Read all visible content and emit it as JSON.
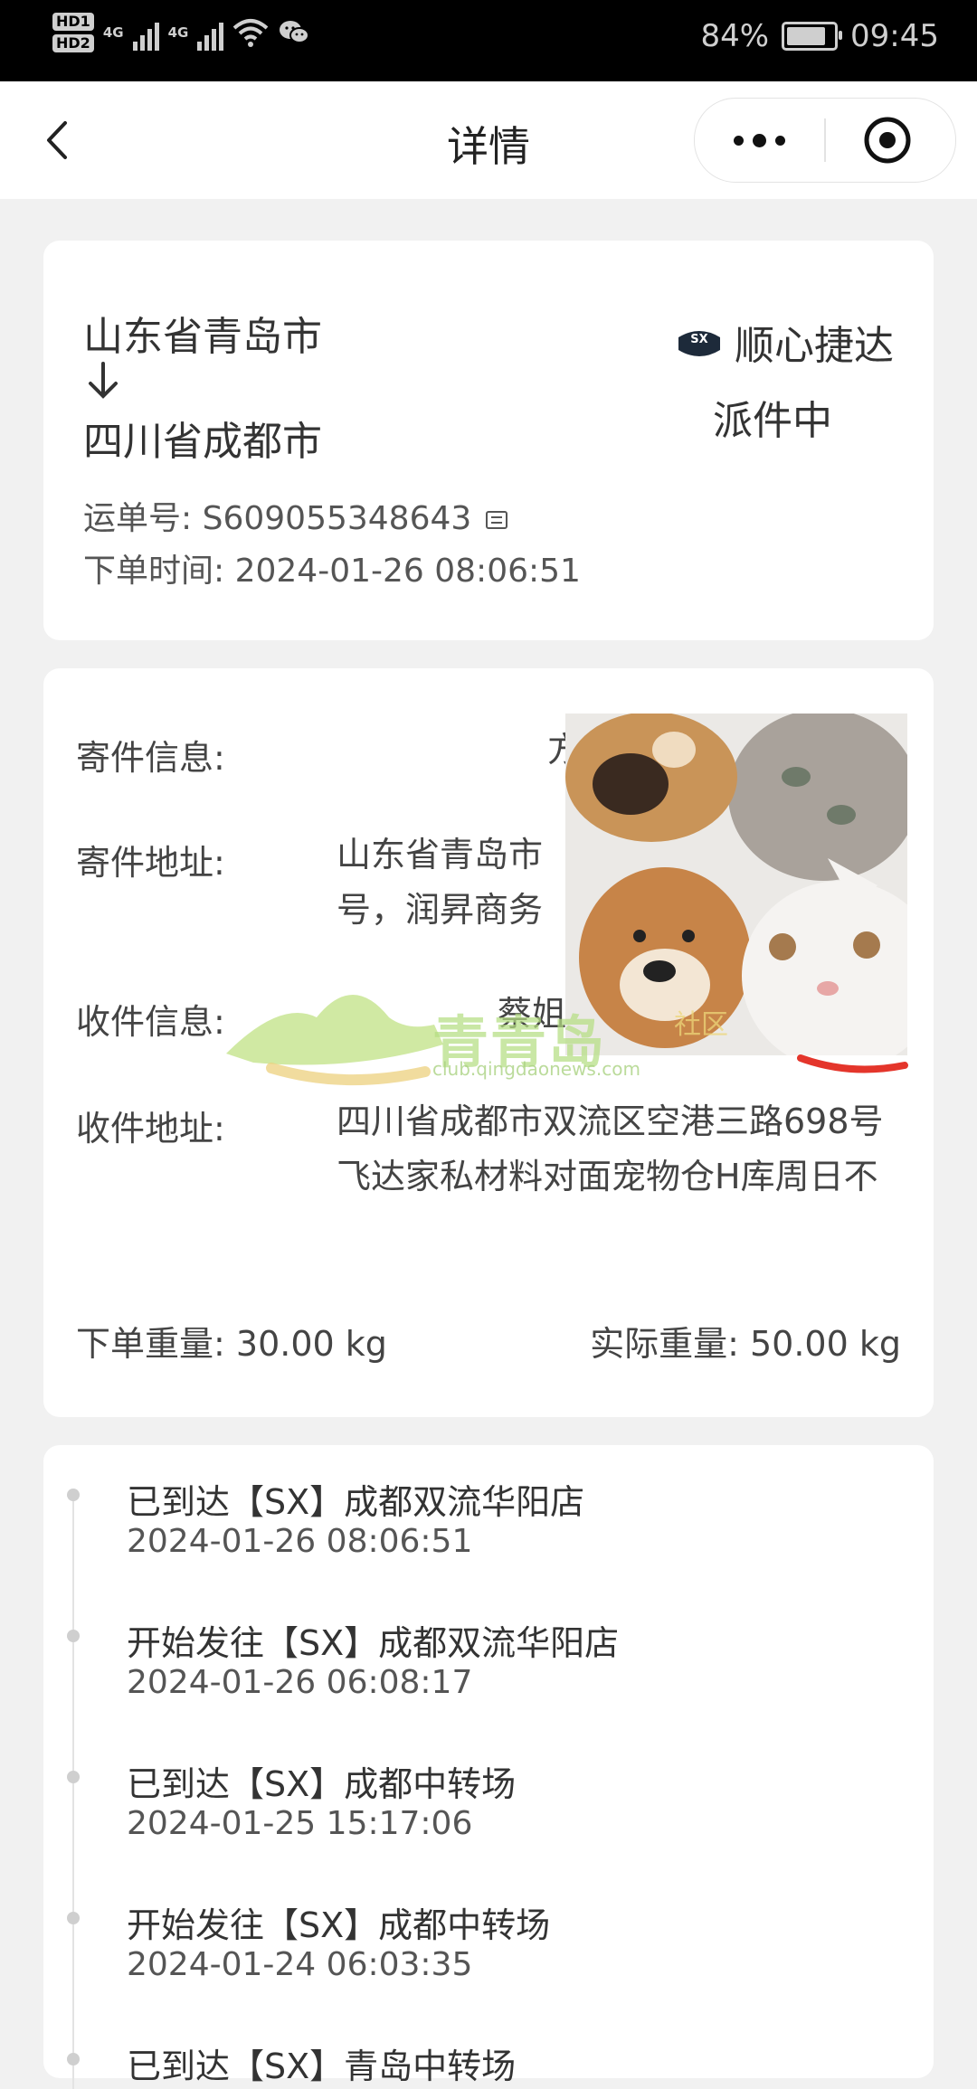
{
  "status_bar": {
    "sim1": "HD1",
    "sim2": "HD2",
    "network1": "4G",
    "network2": "4G",
    "battery_percent": "84%",
    "battery_level": 0.84,
    "time": "09:45"
  },
  "navbar": {
    "title": "详情"
  },
  "shipment": {
    "origin": "山东省青岛市",
    "destination": "四川省成都市",
    "carrier": "顺心捷达",
    "carrier_logo_text": "SX",
    "status": "派件中",
    "waybill_label": "运单号:",
    "waybill_number": "S609055348643",
    "order_time_label": "下单时间:",
    "order_time": "2024-01-26 08:06:51"
  },
  "details": {
    "sender_info_label": "寄件信息:",
    "sender_info_value": "方",
    "sender_address_label": "寄件地址:",
    "sender_address_value": "山东省青岛市",
    "sender_address_value_line2": "号，润昇商务",
    "receiver_info_label": "收件信息:",
    "receiver_info_value": "蔡姐",
    "receiver_address_label": "收件地址:",
    "receiver_address_value": "四川省成都市双流区空港三路698号飞达家私材料对面宠物仓H库周日不",
    "order_weight_label": "下单重量:",
    "order_weight_value": "30.00 kg",
    "actual_weight_label": "实际重量:",
    "actual_weight_value": "50.00 kg"
  },
  "timeline": [
    {
      "title": "已到达【SX】成都双流华阳店",
      "time": "2024-01-26 08:06:51"
    },
    {
      "title": "开始发往【SX】成都双流华阳店",
      "time": "2024-01-26 06:08:17"
    },
    {
      "title": "已到达【SX】成都中转场",
      "time": "2024-01-25 15:17:06"
    },
    {
      "title": "开始发往【SX】成都中转场",
      "time": "2024-01-24 06:03:35"
    },
    {
      "title": "已到达【SX】青岛中转场",
      "time": ""
    }
  ],
  "watermark": {
    "brand": "青青岛",
    "community": "社区",
    "url": "club.qingdaonews.com"
  }
}
